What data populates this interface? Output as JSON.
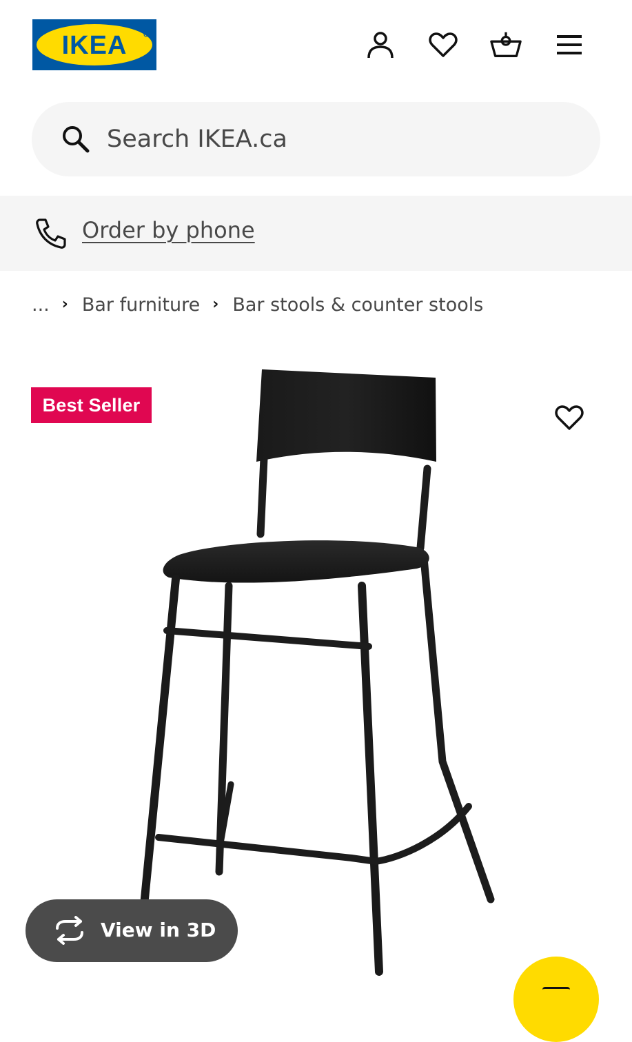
{
  "brand": {
    "logo_text": "IKEA",
    "colors": {
      "blue": "#0058a3",
      "yellow": "#ffdb00"
    }
  },
  "header": {
    "icons": [
      "profile-icon",
      "heart-icon",
      "shopping-bag-icon",
      "hamburger-menu-icon"
    ]
  },
  "search": {
    "placeholder": "Search IKEA.ca",
    "value": ""
  },
  "phone": {
    "label": "Order by phone",
    "icon": "phone-icon"
  },
  "breadcrumb": {
    "ellipsis": "...",
    "items": [
      "Bar furniture",
      "Bar stools & counter stools"
    ]
  },
  "product": {
    "badge": "Best Seller",
    "badge_color": "#e00751",
    "image_alt": "Black bar stool with backrest",
    "view3d_label": "View in 3D"
  },
  "chat": {
    "color": "#ffdb00",
    "icon": "chat-icon"
  }
}
